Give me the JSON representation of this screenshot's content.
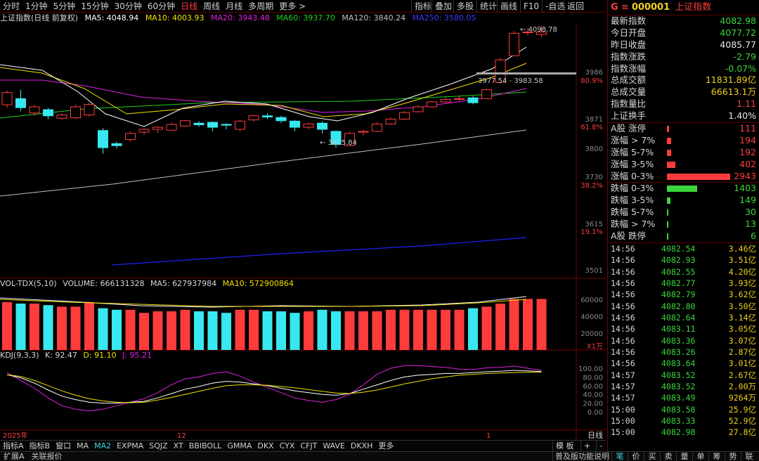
{
  "colors": {
    "up": "#ff3c3c",
    "down": "#38e8f0",
    "ma5": "#ffffff",
    "ma10": "#f0e000",
    "ma20": "#e020e0",
    "ma60": "#20d020",
    "ma120": "#c0c0c0",
    "ma250": "#2020ff",
    "grid": "#7a0000"
  },
  "period_tabs": [
    "分时",
    "1分钟",
    "5分钟",
    "15分钟",
    "30分钟",
    "60分钟",
    "日线",
    "周线",
    "月线",
    "多周期",
    "更多 >"
  ],
  "active_period": "日线",
  "toolbar": [
    "指标",
    "叠加",
    "多股",
    "统计",
    "画线",
    "F10",
    "-自选",
    "返回"
  ],
  "main_info": {
    "title": "上证指数(日线 前复权)",
    "ma5": "MA5: 4048.94",
    "ma10": "MA10: 4003.93",
    "ma20": "MA20: 3943.48",
    "ma60": "MA60: 3937.70",
    "ma120": "MA120: 3840.24",
    "ma250": "MA250: 3580.05"
  },
  "price_axis": [
    "3986",
    "80.9%",
    "3871",
    "61.8%",
    "3800",
    "3730",
    "38.2%",
    "3615",
    "19.1%",
    "3501"
  ],
  "vol_axis": [
    "60000",
    "40000",
    "20000",
    "X1万"
  ],
  "kdj_axis": [
    "100.00",
    "80.00",
    "60.00",
    "40.00",
    "20.00",
    "0.00"
  ],
  "annotations": {
    "high": "4098.78",
    "low": "3815.84",
    "range": "3977.54 - 3983.58"
  },
  "date_labels": [
    "2025年",
    "12",
    "1",
    "日线"
  ],
  "vol_info": {
    "name": "VOL-TDX(5,10)",
    "volume": "VOLUME: 666131328",
    "ma5": "MA5: 627937984",
    "ma10": "MA10: 572900864"
  },
  "kdj_info": {
    "name": "KDJ(9,3,3)",
    "k": "K: 92.47",
    "d": "D: 91.10",
    "j": "J: 95.21"
  },
  "bottom_tabs": [
    "指标A",
    "指标B",
    "窗口",
    "MA",
    "MA2",
    "EXPMA",
    "SQJZ",
    "XT",
    "BBIBOLL",
    "GMMA",
    "DKX",
    "CYX",
    "CFJT",
    "WAVE",
    "DKXH",
    "更多"
  ],
  "active_bottom": "MA2",
  "bottom_right": [
    "模 板",
    "+",
    "-"
  ],
  "status": [
    "扩展A",
    "关联报价"
  ],
  "status_right": [
    "普及版功能说明",
    "笔",
    "价",
    "买",
    "卖",
    "量",
    "单",
    "筹",
    "势",
    "联"
  ],
  "quote": {
    "code": "000001",
    "name": "上证指数",
    "rows": [
      {
        "label": "最新指数",
        "value": "4082.98",
        "color": "#3cd63c"
      },
      {
        "label": "今日开盘",
        "value": "4077.72",
        "color": "#3cd63c"
      },
      {
        "label": "昨日收盘",
        "value": "4085.77",
        "color": "#e8e8e8"
      },
      {
        "label": "指数涨跌",
        "value": "-2.79",
        "color": "#3cd63c"
      },
      {
        "label": "指数涨幅",
        "value": "-0.07%",
        "color": "#3cd63c"
      },
      {
        "label": "总成交额",
        "value": "11831.89亿",
        "color": "#f0d020"
      },
      {
        "label": "总成交量",
        "value": "66613.1万",
        "color": "#f0d020"
      },
      {
        "label": "指数量比",
        "value": "1.11",
        "color": "#ff3c3c"
      },
      {
        "label": "上证换手",
        "value": "1.40%",
        "color": "#e8e8e8"
      }
    ]
  },
  "distribution": [
    {
      "label": "A股 涨停",
      "count": 111,
      "value": "111",
      "color": "#ff3c3c"
    },
    {
      "label": "涨幅 > 7%",
      "count": 194,
      "value": "194",
      "color": "#ff3c3c"
    },
    {
      "label": "涨幅 5-7%",
      "count": 192,
      "value": "192",
      "color": "#ff3c3c"
    },
    {
      "label": "涨幅 3-5%",
      "count": 402,
      "value": "402",
      "color": "#ff3c3c"
    },
    {
      "label": "涨幅 0-3%",
      "count": 2943,
      "value": "2943",
      "color": "#ff3c3c"
    },
    {
      "label": "跌幅 0-3%",
      "count": 1403,
      "value": "1403",
      "color": "#3cd63c"
    },
    {
      "label": "跌幅 3-5%",
      "count": 149,
      "value": "149",
      "color": "#3cd63c"
    },
    {
      "label": "跌幅 5-7%",
      "count": 30,
      "value": "30",
      "color": "#3cd63c"
    },
    {
      "label": "跌幅 > 7%",
      "count": 13,
      "value": "13",
      "color": "#3cd63c"
    },
    {
      "label": "A股 跌停",
      "count": 6,
      "value": "6",
      "color": "#3cd63c"
    }
  ],
  "ticks": [
    {
      "t": "14:56",
      "p": "4082.54",
      "q": "3.46亿"
    },
    {
      "t": "14:56",
      "p": "4082.93",
      "q": "3.51亿"
    },
    {
      "t": "14:56",
      "p": "4082.55",
      "q": "4.20亿"
    },
    {
      "t": "14:56",
      "p": "4082.77",
      "q": "3.93亿"
    },
    {
      "t": "14:56",
      "p": "4082.79",
      "q": "3.62亿"
    },
    {
      "t": "14:56",
      "p": "4082.80",
      "q": "3.50亿"
    },
    {
      "t": "14:56",
      "p": "4082.64",
      "q": "3.14亿"
    },
    {
      "t": "14:56",
      "p": "4083.11",
      "q": "3.05亿"
    },
    {
      "t": "14:56",
      "p": "4083.36",
      "q": "3.07亿"
    },
    {
      "t": "14:56",
      "p": "4083.26",
      "q": "2.87亿"
    },
    {
      "t": "14:56",
      "p": "4083.64",
      "q": "3.01亿"
    },
    {
      "t": "14:57",
      "p": "4083.52",
      "q": "2.67亿"
    },
    {
      "t": "14:57",
      "p": "4083.52",
      "q": "2.00万"
    },
    {
      "t": "14:57",
      "p": "4083.49",
      "q": "9264万"
    },
    {
      "t": "15:00",
      "p": "4083.58",
      "q": "25.9亿"
    },
    {
      "t": "15:00",
      "p": "4083.33",
      "q": "52.9亿"
    },
    {
      "t": "15:00",
      "p": "4082.98",
      "q": "27.8亿"
    }
  ],
  "chart_data": {
    "type": "candlestick",
    "candles": [
      [
        3905,
        3935,
        3898,
        3940
      ],
      [
        3920,
        3898,
        3890,
        3942
      ],
      [
        3885,
        3900,
        3878,
        3905
      ],
      [
        3893,
        3878,
        3870,
        3897
      ],
      [
        3872,
        3880,
        3868,
        3884
      ],
      [
        3873,
        3900,
        3870,
        3905
      ],
      [
        3880,
        3906,
        3876,
        3910
      ],
      [
        3842,
        3800,
        3785,
        3848
      ],
      [
        3810,
        3805,
        3798,
        3815
      ],
      [
        3820,
        3835,
        3815,
        3840
      ],
      [
        3838,
        3845,
        3831,
        3848
      ],
      [
        3845,
        3850,
        3836,
        3852
      ],
      [
        3843,
        3857,
        3841,
        3861
      ],
      [
        3853,
        3866,
        3851,
        3868
      ],
      [
        3860,
        3856,
        3851,
        3865
      ],
      [
        3862,
        3850,
        3840,
        3864
      ],
      [
        3857,
        3855,
        3845,
        3860
      ],
      [
        3845,
        3865,
        3840,
        3868
      ],
      [
        3868,
        3878,
        3864,
        3880
      ],
      [
        3878,
        3875,
        3870,
        3885
      ],
      [
        3874,
        3866,
        3860,
        3878
      ],
      [
        3865,
        3850,
        3840,
        3868
      ],
      [
        3850,
        3858,
        3845,
        3862
      ],
      [
        3860,
        3845,
        3835,
        3864
      ],
      [
        3840,
        3808,
        3800,
        3842
      ],
      [
        3805,
        3835,
        3803,
        3838
      ],
      [
        3838,
        3840,
        3830,
        3844
      ],
      [
        3840,
        3858,
        3838,
        3862
      ],
      [
        3858,
        3870,
        3856,
        3874
      ],
      [
        3870,
        3886,
        3868,
        3890
      ],
      [
        3888,
        3900,
        3886,
        3904
      ],
      [
        3900,
        3912,
        3898,
        3914
      ],
      [
        3912,
        3918,
        3910,
        3924
      ],
      [
        3920,
        3920,
        3915,
        3926
      ],
      [
        3922,
        3910,
        3906,
        3926
      ],
      [
        3920,
        3942,
        3918,
        3944
      ],
      [
        3960,
        4015,
        3958,
        4020
      ],
      [
        4025,
        4080,
        4024,
        4085
      ],
      [
        4082,
        4083,
        4075,
        4093
      ],
      [
        4077,
        4083,
        4070,
        4098
      ]
    ],
    "volumes": [
      62,
      60,
      60,
      58,
      56,
      56,
      62,
      54,
      52,
      52,
      48,
      50,
      50,
      52,
      50,
      50,
      48,
      52,
      52,
      50,
      50,
      48,
      50,
      52,
      50,
      50,
      50,
      50,
      52,
      52,
      52,
      52,
      52,
      52,
      54,
      56,
      60,
      66,
      66,
      66
    ],
    "kdj_k": [
      85,
      78,
      66,
      50,
      36,
      28,
      22,
      20,
      20,
      22,
      24,
      32,
      42,
      52,
      58,
      66,
      70,
      68,
      64,
      60,
      54,
      48,
      44,
      40,
      38,
      42,
      52,
      62,
      72,
      80,
      84,
      86,
      88,
      88,
      90,
      92,
      93,
      95,
      94,
      92.47
    ],
    "kdj_d": [
      85,
      81,
      72,
      60,
      48,
      38,
      30,
      25,
      22,
      21,
      22,
      27,
      33,
      40,
      47,
      54,
      60,
      62,
      62,
      61,
      58,
      55,
      51,
      47,
      43,
      42,
      45,
      50,
      57,
      64,
      70,
      76,
      80,
      84,
      86,
      88,
      89,
      90,
      91,
      91.1
    ],
    "kdj_j": [
      90,
      72,
      54,
      32,
      14,
      6,
      2,
      6,
      14,
      22,
      30,
      44,
      62,
      76,
      80,
      88,
      92,
      82,
      68,
      56,
      44,
      32,
      26,
      22,
      28,
      40,
      62,
      86,
      100,
      106,
      106,
      104,
      102,
      98,
      97,
      101,
      102,
      105,
      100,
      95.21
    ]
  }
}
